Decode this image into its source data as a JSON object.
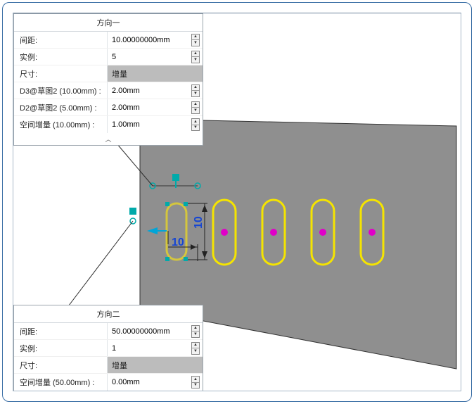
{
  "panel1": {
    "header": "方向一",
    "rows": [
      {
        "label": "间距:",
        "value": "10.00000000mm",
        "spin": true
      },
      {
        "label": "实例:",
        "value": "5",
        "spin": true
      },
      {
        "label": "尺寸:",
        "value": "增量",
        "gray": true
      },
      {
        "label": "D3@草图2 (10.00mm) :",
        "value": "2.00mm",
        "spin": true
      },
      {
        "label": "D2@草图2 (5.00mm) :",
        "value": "2.00mm",
        "spin": true
      },
      {
        "label": "空间增量 (10.00mm) :",
        "value": "1.00mm",
        "spin": true
      }
    ]
  },
  "panel2": {
    "header": "方向二",
    "rows": [
      {
        "label": "间距:",
        "value": "50.00000000mm",
        "spin": true
      },
      {
        "label": "实例:",
        "value": "1",
        "spin": true
      },
      {
        "label": "尺寸:",
        "value": "增量",
        "gray": true
      },
      {
        "label": "空间增量 (50.00mm) :",
        "value": "0.00mm",
        "spin": true
      }
    ]
  },
  "scene": {
    "dim_horizontal": "10",
    "dim_vertical": "10"
  },
  "colors": {
    "face": "#8f8f8f",
    "slot_seed": "#d4c63e",
    "slot_inst": "#f5e400",
    "center_pt": "#e000c8",
    "dim_blue": "#1646d2",
    "handle_cyan": "#00a5d8"
  },
  "chart_data": {
    "type": "table",
    "title": "Linear Pattern Parameters",
    "series": [
      {
        "name": "方向一",
        "values": {
          "间距_mm": 10.0,
          "实例": 5,
          "尺寸": "增量",
          "D3@草图2_mm": 2.0,
          "D2@草图2_mm": 2.0,
          "空间增量_mm": 1.0
        }
      },
      {
        "name": "方向二",
        "values": {
          "间距_mm": 50.0,
          "实例": 1,
          "尺寸": "增量",
          "空间增量_mm": 0.0
        }
      }
    ],
    "sketch_dims": {
      "horizontal": 10,
      "vertical": 10
    }
  }
}
